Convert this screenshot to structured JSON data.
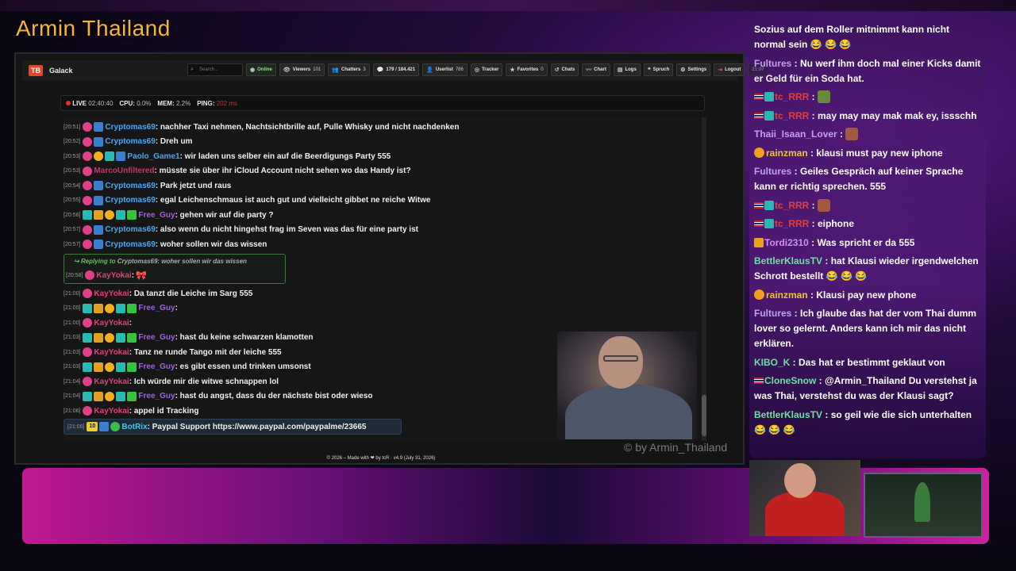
{
  "stream_title": "Armin Thailand",
  "app": {
    "logo_text": "TB",
    "name": "Galack",
    "search_placeholder": "Search...",
    "nav": [
      {
        "label": "Online",
        "value": "",
        "icon": "online-icon"
      },
      {
        "label": "Viewers",
        "value": "101",
        "icon": "eye-icon"
      },
      {
        "label": "Chatters",
        "value": "3",
        "icon": "users-icon"
      },
      {
        "label": "179 / 184.421",
        "value": "",
        "icon": "chat-bubble-icon"
      },
      {
        "label": "Userlist",
        "value": "786",
        "icon": "user-icon"
      },
      {
        "label": "Tracker",
        "value": "",
        "icon": "tracker-icon"
      },
      {
        "label": "Favorites",
        "value": "0",
        "icon": "star-icon"
      },
      {
        "label": "Chats",
        "value": "",
        "icon": "history-icon"
      },
      {
        "label": "Chart",
        "value": "",
        "icon": "chart-icon"
      },
      {
        "label": "Logs",
        "value": "",
        "icon": "logs-icon"
      },
      {
        "label": "Spruch",
        "value": "",
        "icon": "quote-icon"
      },
      {
        "label": "Settings",
        "value": "",
        "icon": "gear-icon"
      },
      {
        "label": "Logout",
        "value": "",
        "icon": "logout-icon"
      }
    ],
    "clock": "21:07"
  },
  "status": {
    "live_label": "LIVE",
    "live_time": "02:40:40",
    "cpu_label": "CPU:",
    "cpu_value": "0.0%",
    "mem_label": "MEM:",
    "mem_value": "2.2%",
    "ping_label": "PING:",
    "ping_value": "202 ms"
  },
  "colors": {
    "crypto": "#4aa8f0",
    "paolo": "#4aa8f0",
    "marco": "#d0306a",
    "freeguy": "#a060e0",
    "kay": "#e0407a",
    "botrix": "#4ac0f0",
    "title": "#f3b63a"
  },
  "messages": [
    {
      "ts": "[20:51]",
      "nick": "Cryptomas69",
      "color": "#4aa8f0",
      "badges": [
        "pink",
        "blue"
      ],
      "text": ": nachher Taxi nehmen, Nachtsichtbrille auf, Pulle Whisky und nicht nachdenken"
    },
    {
      "ts": "[20:52]",
      "nick": "Cryptomas69",
      "color": "#4aa8f0",
      "badges": [
        "pink",
        "blue"
      ],
      "text": ": Dreh um"
    },
    {
      "ts": "[20:53]",
      "nick": "Paolo_Game1",
      "color": "#4aa8f0",
      "badges": [
        "pink",
        "gold",
        "teal",
        "blue"
      ],
      "text": ": wir laden uns selber ein auf die Beerdigungs Party 555"
    },
    {
      "ts": "[20:53]",
      "nick": "MarcoUnfiltered",
      "color": "#d0306a",
      "badges": [
        "pink"
      ],
      "text": ": müsste sie über ihr iCloud Account nicht sehen wo das Handy ist?"
    },
    {
      "ts": "[20:54]",
      "nick": "Cryptomas69",
      "color": "#4aa8f0",
      "badges": [
        "pink",
        "blue"
      ],
      "text": ": Park jetzt und raus"
    },
    {
      "ts": "[20:55]",
      "nick": "Cryptomas69",
      "color": "#4aa8f0",
      "badges": [
        "pink",
        "blue"
      ],
      "text": ": egal Leichenschmaus ist auch gut und vielleicht gibbet ne reiche Witwe"
    },
    {
      "ts": "[20:56]",
      "nick": "Free_Guy",
      "color": "#a060e0",
      "badges": [
        "teal",
        "crown",
        "gold",
        "teal",
        "green"
      ],
      "text": ": gehen wir auf die party ?"
    },
    {
      "ts": "[20:57]",
      "nick": "Cryptomas69",
      "color": "#4aa8f0",
      "badges": [
        "pink",
        "blue"
      ],
      "text": ": also wenn du nicht hingehst frag im Seven was das für eine party ist"
    },
    {
      "ts": "[20:57]",
      "nick": "Cryptomas69",
      "color": "#4aa8f0",
      "badges": [
        "pink",
        "blue"
      ],
      "text": ": woher sollen wir das wissen"
    }
  ],
  "reply": {
    "label": "Replying to",
    "target": "Cryptomas69: woher sollen wir das wissen",
    "ts": "[20:58]",
    "nick": "KayYokai",
    "text": ":"
  },
  "messages2": [
    {
      "ts": "[21:00]",
      "nick": "KayYokai",
      "color": "#e0407a",
      "badges": [
        "pink"
      ],
      "text": ": Da tanzt die Leiche im Sarg 555"
    },
    {
      "ts": "[21:00]",
      "nick": "Free_Guy",
      "color": "#a060e0",
      "badges": [
        "teal",
        "crown",
        "gold",
        "teal",
        "green"
      ],
      "text": ":"
    },
    {
      "ts": "[21:00]",
      "nick": "KayYokai",
      "color": "#e0407a",
      "badges": [
        "pink"
      ],
      "text": ":"
    },
    {
      "ts": "[21:03]",
      "nick": "Free_Guy",
      "color": "#a060e0",
      "badges": [
        "teal",
        "crown",
        "gold",
        "teal",
        "green"
      ],
      "text": ": hast du keine schwarzen klamotten"
    },
    {
      "ts": "[21:03]",
      "nick": "KayYokai",
      "color": "#e0407a",
      "badges": [
        "pink"
      ],
      "text": ": Tanz ne runde Tango mit der leiche 555"
    },
    {
      "ts": "[21:03]",
      "nick": "Free_Guy",
      "color": "#a060e0",
      "badges": [
        "teal",
        "crown",
        "gold",
        "teal",
        "green"
      ],
      "text": ": es gibt essen und trinken umsonst"
    },
    {
      "ts": "[21:04]",
      "nick": "KayYokai",
      "color": "#e0407a",
      "badges": [
        "pink"
      ],
      "text": ": Ich würde mir die witwe schnappen lol"
    },
    {
      "ts": "[21:04]",
      "nick": "Free_Guy",
      "color": "#a060e0",
      "badges": [
        "teal",
        "crown",
        "gold",
        "teal",
        "green"
      ],
      "text": ": hast du angst, dass du der nächste bist oder wieso"
    },
    {
      "ts": "[21:06]",
      "nick": "KayYokai",
      "color": "#e0407a",
      "badges": [
        "pink"
      ],
      "text": ": appel id Tracking"
    }
  ],
  "bot": {
    "ts": "[21:06]",
    "badge": "10",
    "nick": "BotRix",
    "text": ": Paypal Support https://www.paypal.com/paypalme/23665"
  },
  "footer": "© 2026 – Made with ❤ by tcR · v4.9 (July 31, 2026)",
  "watermark": "© by Armin_Thailand",
  "right_chat": [
    {
      "nick": "",
      "color": "#fff",
      "text": "Sozius auf dem Roller mitnimmt kann nicht normal sein 😂 😂 😂"
    },
    {
      "nick": "Fultures",
      "color": "#c0a0f0",
      "text": " : Nu werf ihm doch mal einer Kicks damit er Geld für ein Soda hat."
    },
    {
      "nick": "tc_RRR",
      "color": "#e04040",
      "text": " :"
    },
    {
      "nick": "tc_RRR",
      "color": "#e04040",
      "text": " : may may may mak mak ey, issschh"
    },
    {
      "nick": "Thaii_Isaan_Lover",
      "color": "#c0a0f0",
      "text": " :"
    },
    {
      "nick": "rainzman",
      "color": "#f0c040",
      "text": " : klausi must pay new iphone"
    },
    {
      "nick": "Fultures",
      "color": "#c0a0f0",
      "text": " : Geiles Gespräch auf keiner Sprache kann er richtig sprechen. 555"
    },
    {
      "nick": "tc_RRR",
      "color": "#e04040",
      "text": " :"
    },
    {
      "nick": "tc_RRR",
      "color": "#e04040",
      "text": " : eiphone"
    },
    {
      "nick": "Tordi2310",
      "color": "#d090f0",
      "text": " : Was spricht er da 555"
    },
    {
      "nick": "BettlerKlausTV",
      "color": "#70e0a0",
      "text": " : hat Klausi wieder irgendwelchen Schrott bestellt 😂 😂 😂"
    },
    {
      "nick": "rainzman",
      "color": "#f0c040",
      "text": " : Klausi pay new phone"
    },
    {
      "nick": "Fultures",
      "color": "#c0a0f0",
      "text": " : Ich glaube das hat der vom Thai dumm lover so gelernt. Anders kann ich mir das nicht erklären."
    },
    {
      "nick": "KIBO_K",
      "color": "#70e0a0",
      "text": " : Das hat er bestimmt geklaut von"
    },
    {
      "nick": "CloneSnow",
      "color": "#70e0a0",
      "text": " : @Armin_Thailand Du verstehst ja was Thai, verstehst du was der Klausi sagt?"
    },
    {
      "nick": "BettlerKlausTV",
      "color": "#70e0a0",
      "text": " : so geil wie die sich unterhalten 😂 😂 😂"
    }
  ]
}
